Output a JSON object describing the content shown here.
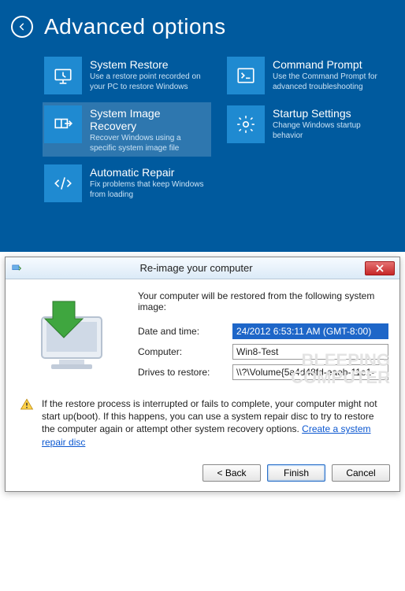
{
  "winre": {
    "title": "Advanced options",
    "tiles": [
      {
        "title": "System Restore",
        "desc": "Use a restore point recorded on your PC to restore Windows"
      },
      {
        "title": "Command Prompt",
        "desc": "Use the Command Prompt for advanced troubleshooting"
      },
      {
        "title": "System Image Recovery",
        "desc": "Recover Windows using a specific system image file"
      },
      {
        "title": "Startup Settings",
        "desc": "Change Windows startup behavior"
      },
      {
        "title": "Automatic Repair",
        "desc": "Fix problems that keep Windows from loading"
      }
    ]
  },
  "dialog": {
    "title": "Re-image your computer",
    "intro": "Your computer will be restored from the following system image:",
    "labels": {
      "datetime": "Date and time:",
      "computer": "Computer:",
      "drives": "Drives to restore:"
    },
    "values": {
      "datetime": "24/2012 6:53:11 AM (GMT-8:00)",
      "computer": "Win8-Test",
      "drives": "\\\\?\\Volume{5a4d48fd-eaeb-11e1-"
    },
    "warning": "If the restore process is interrupted or fails to complete, your computer might not start up(boot). If this happens, you can use a system repair disc to try to restore the computer again or attempt other system recovery options.",
    "warn_link": "Create a system repair disc",
    "buttons": {
      "back": "< Back",
      "finish": "Finish",
      "cancel": "Cancel"
    }
  },
  "watermark": {
    "line1": "BLEEPING",
    "line2": "COMPUTER"
  }
}
